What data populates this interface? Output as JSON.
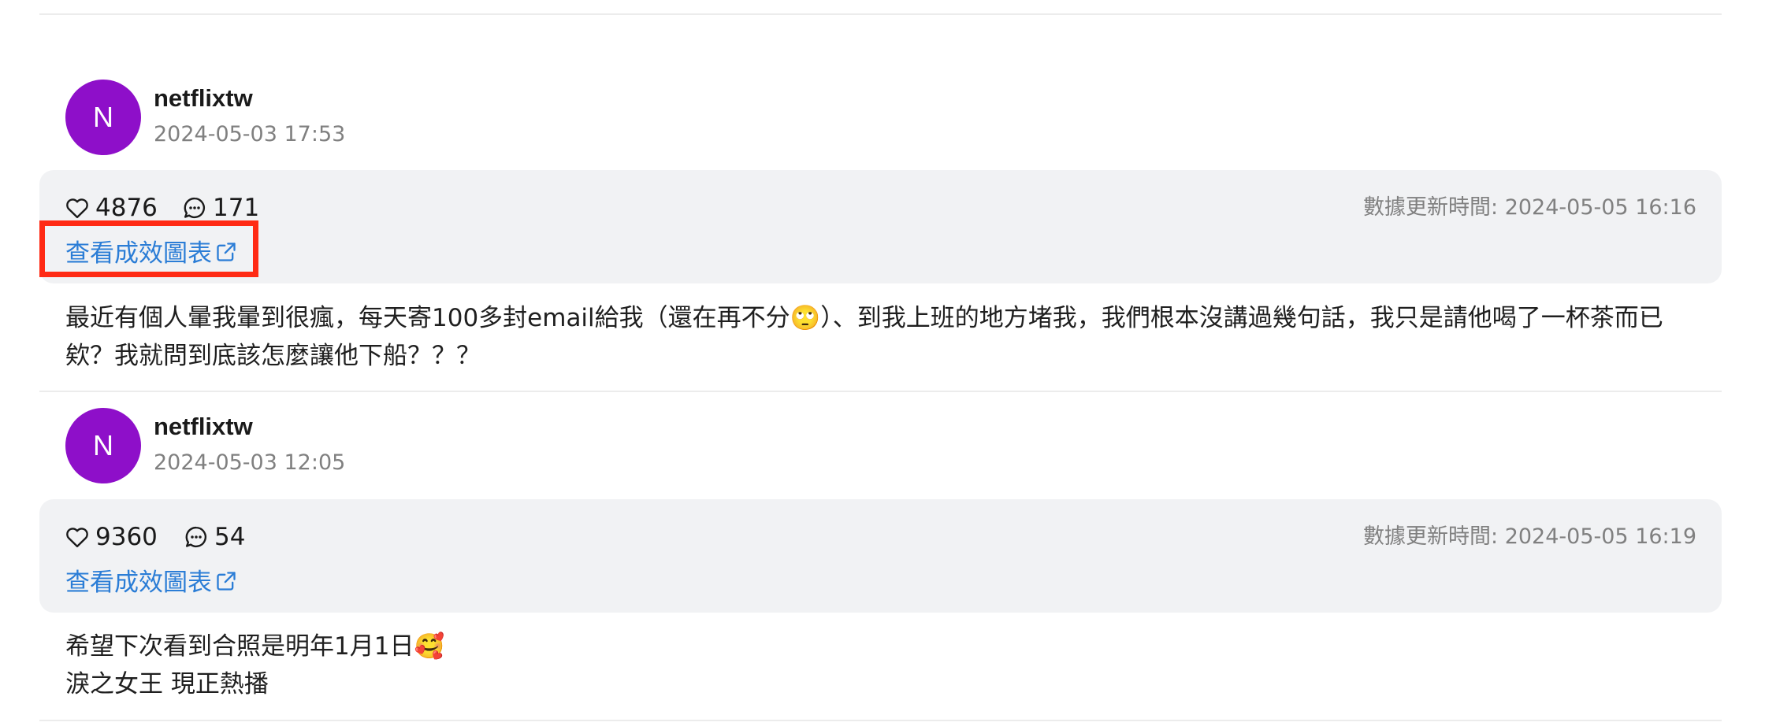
{
  "posts": [
    {
      "avatar_letter": "N",
      "username": "netflixtw",
      "posted_at": "2024-05-03 17:53",
      "likes": "4876",
      "comments": "171",
      "chart_link_label": "查看成效圖表",
      "updated_label": "數據更新時間: 2024-05-05 16:16",
      "content_lines": [
        "最近有個人暈我暈到很瘋，每天寄100多封email給我（還在再不分🙄）、到我上班的地方堵我，我們根本沒講過幾句話，我只是請他喝了一杯茶而已",
        "欸？我就問到底該怎麼讓他下船？？？"
      ],
      "highlighted": true
    },
    {
      "avatar_letter": "N",
      "username": "netflixtw",
      "posted_at": "2024-05-03 12:05",
      "likes": "9360",
      "comments": "54",
      "chart_link_label": "查看成效圖表",
      "updated_label": "數據更新時間: 2024-05-05 16:19",
      "content_lines": [
        "希望下次看到合照是明年1月1日🥰",
        "淚之女王 現正熱播"
      ],
      "highlighted": false
    }
  ],
  "colors": {
    "avatar": "#8e0fc9",
    "link": "#2b7dd6",
    "stats_bg": "#f1f2f4",
    "muted_text": "#808080",
    "highlight": "#ff2a14"
  },
  "icons": {
    "likes": "heart-icon",
    "comments": "chat-bubble-icon",
    "external": "external-link-icon"
  }
}
